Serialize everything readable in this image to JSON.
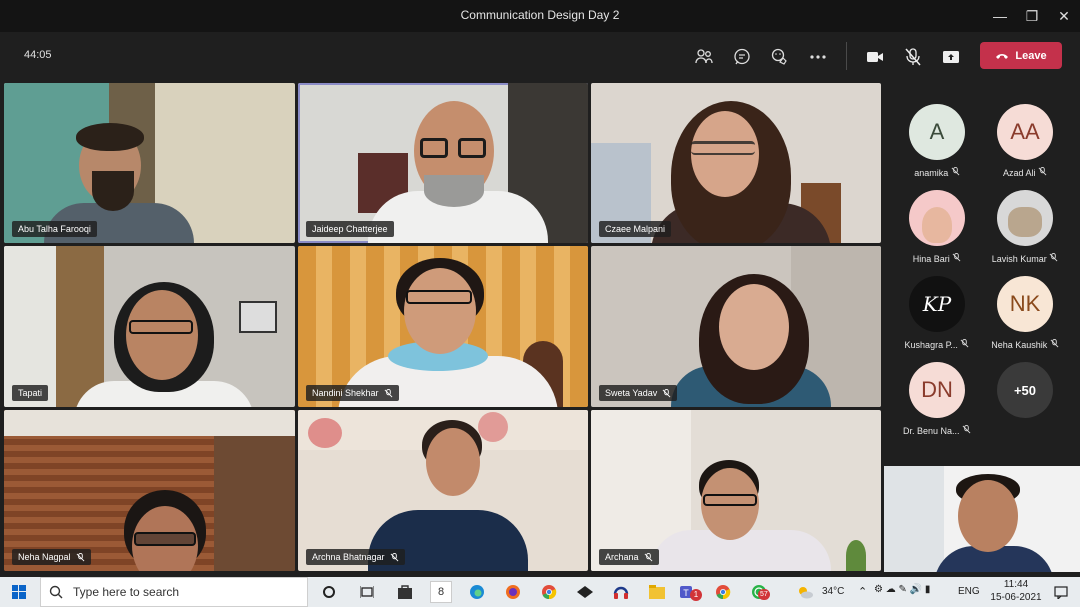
{
  "window": {
    "title": "Communication Design Day 2"
  },
  "toolbar": {
    "timer": "44:05",
    "leave_label": "Leave",
    "icons": [
      "participants-icon",
      "chat-icon",
      "reactions-icon",
      "more-icon",
      "camera-icon",
      "mic-off-icon",
      "share-icon"
    ]
  },
  "tiles": [
    {
      "name": "Abu Talha Farooqi",
      "muted": false
    },
    {
      "name": "Jaideep Chatterjee",
      "muted": false,
      "speaking": true
    },
    {
      "name": "Czaee Malpani",
      "muted": false
    },
    {
      "name": "Tapati",
      "muted": false
    },
    {
      "name": "Nandini Shekhar",
      "muted": true
    },
    {
      "name": "Sweta Yadav",
      "muted": true
    },
    {
      "name": "Neha Nagpal",
      "muted": true
    },
    {
      "name": "Archna Bhatnagar",
      "muted": true
    },
    {
      "name": "Archana",
      "muted": true
    }
  ],
  "roster": [
    {
      "initials": "A",
      "name": "anamika",
      "color": "#dfe8e0",
      "text_color": "#3a4a3a"
    },
    {
      "initials": "AA",
      "name": "Azad Ali",
      "color": "#f6dcd6",
      "text_color": "#8a3b2c"
    },
    {
      "initials": "",
      "name": "Hina Bari",
      "color": "#f5c9c9",
      "text_color": "#333"
    },
    {
      "initials": "",
      "name": "Lavish Kumar",
      "color": "#d8d8d8",
      "text_color": "#333"
    },
    {
      "initials": "KP",
      "name": "Kushagra P...",
      "color": "#111111",
      "text_color": "#ffffff"
    },
    {
      "initials": "NK",
      "name": "Neha Kaushik",
      "color": "#f8e6d5",
      "text_color": "#8a4a1c"
    },
    {
      "initials": "DN",
      "name": "Dr. Benu Na...",
      "color": "#f6dcd6",
      "text_color": "#8a3b2c"
    },
    {
      "initials": "+50",
      "name": "",
      "color": "#3a3a3a",
      "text_color": "#ffffff"
    }
  ],
  "taskbar": {
    "search_placeholder": "Type here to search",
    "weather": "34°C",
    "language": "ENG",
    "time": "11:44",
    "date": "15-06-2021",
    "whatsapp_badge": "57",
    "teams_badge": "1",
    "app8_label": "8"
  }
}
